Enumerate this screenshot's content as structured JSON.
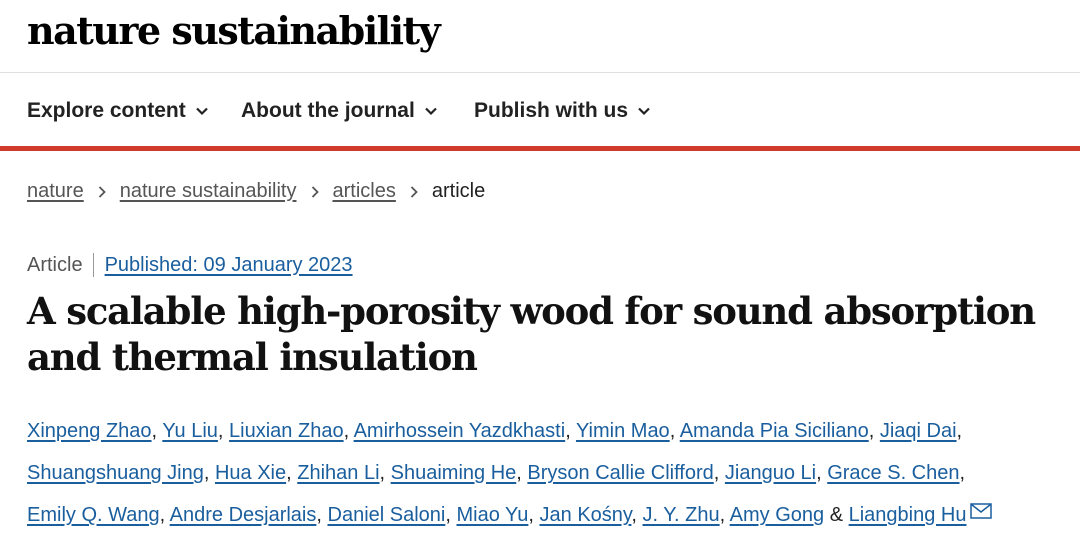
{
  "header": {
    "logo": "nature sustainability"
  },
  "nav": {
    "items": [
      {
        "label": "Explore content"
      },
      {
        "label": "About the journal"
      },
      {
        "label": "Publish with us"
      }
    ]
  },
  "breadcrumbs": {
    "items": [
      "nature",
      "nature sustainability",
      "articles"
    ],
    "current": "article"
  },
  "article": {
    "type": "Article",
    "published": "Published: 09 January 2023",
    "title_line1": "A scalable high-porosity wood for sound absorption",
    "title_line2": "and thermal insulation",
    "authors": [
      "Xinpeng Zhao",
      "Yu Liu",
      "Liuxian Zhao",
      "Amirhossein Yazdkhasti",
      "Yimin Mao",
      "Amanda Pia Siciliano",
      "Jiaqi Dai",
      "Shuangshuang Jing",
      "Hua Xie",
      "Zhihan Li",
      "Shuaiming He",
      "Bryson Callie Clifford",
      "Jianguo Li",
      "Grace S. Chen",
      "Emily Q. Wang",
      "Andre Desjarlais",
      "Daniel Saloni",
      "Miao Yu",
      "Jan Kośny",
      "J. Y. Zhu",
      "Amy Gong",
      "Liangbing Hu"
    ],
    "ampersand": "&",
    "mail_icon": "envelope-icon"
  }
}
